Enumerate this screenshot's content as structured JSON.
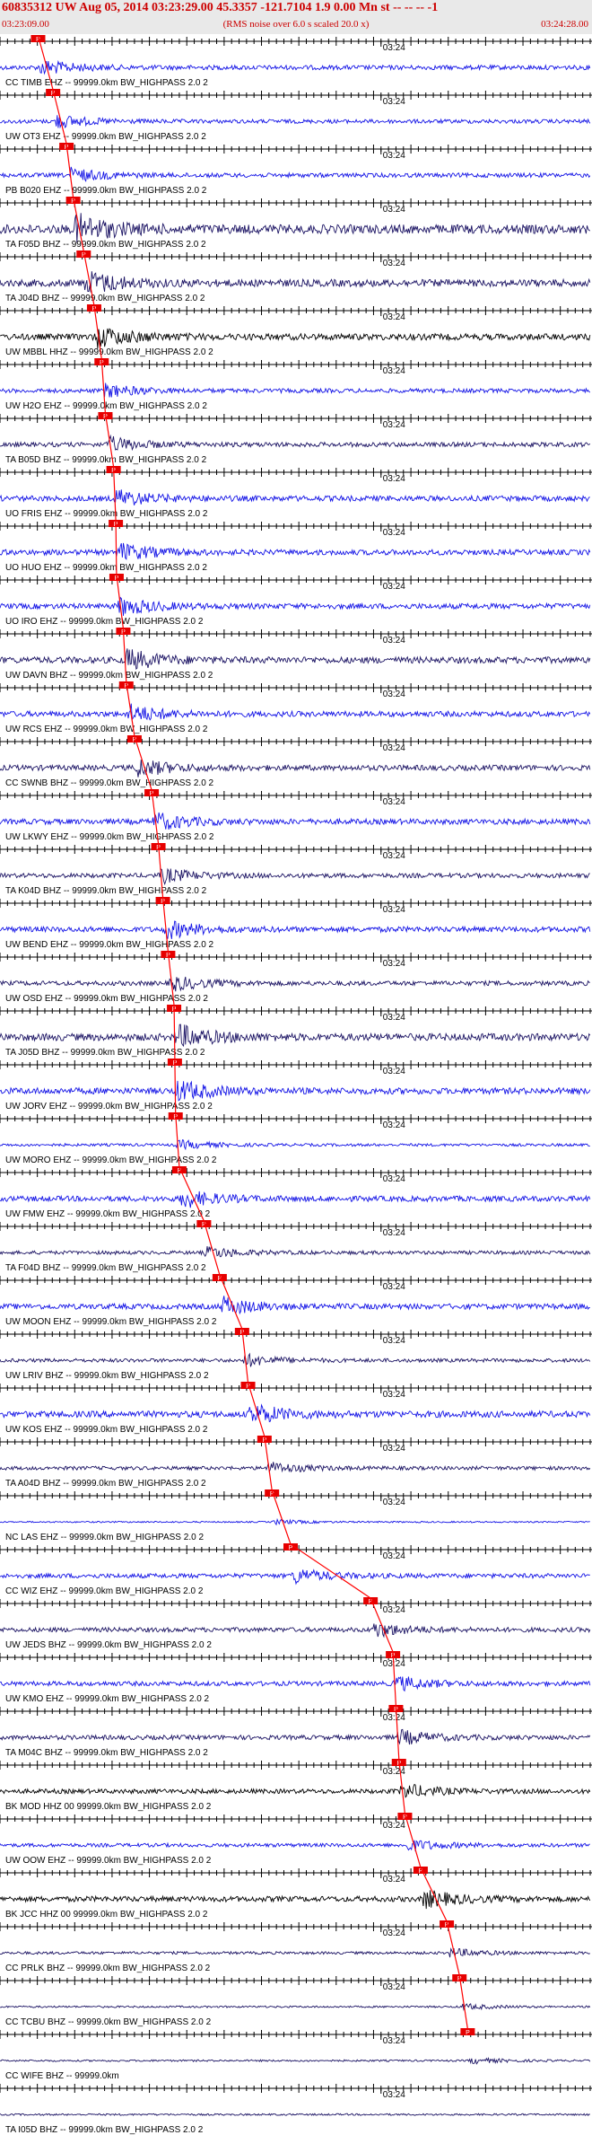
{
  "header": {
    "title": "60835312 UW Aug 05, 2014 03:23:29.00   45.3357 -121.7104  1.9 0.00 Mn st -- -- --  -1",
    "subtitle": "(RMS noise over 6.0 s scaled 20.0 x)",
    "start_time": "03:23:09.00",
    "end_time": "03:24:28.00",
    "title_color": "#cc0000"
  },
  "chart_data": {
    "type": "seismogram-record-section",
    "x_unit": "s",
    "time_window_s": [
      0,
      79
    ],
    "minute_mark_label": "03:24",
    "minute_mark_s": 51,
    "tick_major_s": 5,
    "tick_minor_s": 1,
    "pick_label": "P",
    "colors": {
      "blue": "#1414e6",
      "navy": "#1c1464",
      "black": "#000000",
      "pick": "#ff0000",
      "pick_box": "#e60000"
    },
    "traces": [
      {
        "label": "CC TIMB EHZ -- 99999.0km BW_HIGHPASS 2.0 2",
        "color": "blue",
        "amp": 2.5,
        "pick_s": 5.1
      },
      {
        "label": "UW OT3 EHZ -- 99999.0km BW_HIGHPASS 2.0 2",
        "color": "blue",
        "amp": 2.2,
        "pick_s": 7.1
      },
      {
        "label": "PB B020 EHZ -- 99999.0km BW_HIGHPASS 2.0 2",
        "color": "blue",
        "amp": 2.4,
        "pick_s": 8.9
      },
      {
        "label": "TA F05D BHZ -- 99999.0km BW_HIGHPASS 2.0 2",
        "color": "navy",
        "amp": 5.0,
        "pick_s": 9.8
      },
      {
        "label": "TA J04D BHZ -- 99999.0km BW_HIGHPASS 2.0 2",
        "color": "navy",
        "amp": 4.0,
        "pick_s": 11.2
      },
      {
        "label": "UW MBBL HHZ -- 99999.0km BW_HIGHPASS 2.0 2",
        "color": "black",
        "amp": 3.5,
        "pick_s": 12.6
      },
      {
        "label": "UW H2O EHZ -- 99999.0km BW_HIGHPASS 2.0 2",
        "color": "blue",
        "amp": 2.3,
        "pick_s": 13.6
      },
      {
        "label": "TA B05D BHZ -- 99999.0km BW_HIGHPASS 2.0 2",
        "color": "navy",
        "amp": 2.5,
        "pick_s": 14.1
      },
      {
        "label": "UO FRIS EHZ -- 99999.0km BW_HIGHPASS 2.0 2",
        "color": "blue",
        "amp": 3.0,
        "pick_s": 15.2
      },
      {
        "label": "UO HUO EHZ -- 99999.0km BW_HIGHPASS 2.0 2",
        "color": "blue",
        "amp": 3.0,
        "pick_s": 15.5
      },
      {
        "label": "UO IRO EHZ -- 99999.0km BW_HIGHPASS 2.0 2",
        "color": "blue",
        "amp": 3.0,
        "pick_s": 15.6
      },
      {
        "label": "UW DAVN BHZ -- 99999.0km BW_HIGHPASS 2.0 2",
        "color": "navy",
        "amp": 3.5,
        "pick_s": 16.5
      },
      {
        "label": "UW RCS EHZ -- 99999.0km BW_HIGHPASS 2.0 2",
        "color": "blue",
        "amp": 3.0,
        "pick_s": 16.9
      },
      {
        "label": "CC SWNB BHZ -- 99999.0km BW_HIGHPASS 2.0 2",
        "color": "navy",
        "amp": 3.0,
        "pick_s": 18.0
      },
      {
        "label": "UW LKWY EHZ -- 99999.0km BW_HIGHPASS 2.0 2",
        "color": "blue",
        "amp": 3.0,
        "pick_s": 20.3
      },
      {
        "label": "TA K04D BHZ -- 99999.0km BW_HIGHPASS 2.0 2",
        "color": "navy",
        "amp": 2.5,
        "pick_s": 21.2
      },
      {
        "label": "UW BEND EHZ -- 99999.0km BW_HIGHPASS 2.0 2",
        "color": "blue",
        "amp": 3.0,
        "pick_s": 21.8
      },
      {
        "label": "UW OSD EHZ -- 99999.0km BW_HIGHPASS 2.0 2",
        "color": "navy",
        "amp": 2.5,
        "pick_s": 22.5
      },
      {
        "label": "TA J05D BHZ -- 99999.0km BW_HIGHPASS 2.0 2",
        "color": "navy",
        "amp": 4.0,
        "pick_s": 23.3
      },
      {
        "label": "UW JORV EHZ -- 99999.0km BW_HIGHPASS 2.0 2",
        "color": "blue",
        "amp": 3.5,
        "pick_s": 23.4
      },
      {
        "label": "UW MORO EHZ -- 99999.0km BW_HIGHPASS 2.0 2",
        "color": "blue",
        "amp": 1.5,
        "pick_s": 23.5
      },
      {
        "label": "UW FMW EHZ -- 99999.0km BW_HIGHPASS 2.0 2",
        "color": "blue",
        "amp": 3.0,
        "pick_s": 24.0
      },
      {
        "label": "TA F04D BHZ -- 99999.0km BW_HIGHPASS 2.0 2",
        "color": "navy",
        "amp": 2.0,
        "pick_s": 27.3
      },
      {
        "label": "UW MOON EHZ -- 99999.0km BW_HIGHPASS 2.0 2",
        "color": "blue",
        "amp": 3.0,
        "pick_s": 29.4
      },
      {
        "label": "UW LRIV BHZ -- 99999.0km BW_HIGHPASS 2.0 2",
        "color": "navy",
        "amp": 2.0,
        "pick_s": 32.4
      },
      {
        "label": "UW KOS EHZ -- 99999.0km BW_HIGHPASS 2.0 2",
        "color": "blue",
        "amp": 3.5,
        "pick_s": 33.2
      },
      {
        "label": "TA A04D BHZ -- 99999.0km BW_HIGHPASS 2.0 2",
        "color": "navy",
        "amp": 2.0,
        "pick_s": 35.4
      },
      {
        "label": "NC LAS EHZ -- 99999.0km BW_HIGHPASS 2.0 2",
        "color": "blue",
        "amp": 0.8,
        "pick_s": 36.4
      },
      {
        "label": "CC WIZ EHZ -- 99999.0km BW_HIGHPASS 2.0 2",
        "color": "blue",
        "amp": 2.5,
        "pick_s": 38.9
      },
      {
        "label": "UW JEDS BHZ -- 99999.0km BW_HIGHPASS 2.0 2",
        "color": "navy",
        "amp": 2.5,
        "pick_s": 49.6
      },
      {
        "label": "UW KMO EHZ -- 99999.0km BW_HIGHPASS 2.0 2",
        "color": "blue",
        "amp": 2.5,
        "pick_s": 52.6
      },
      {
        "label": "TA M04C BHZ -- 99999.0km BW_HIGHPASS 2.0 2",
        "color": "navy",
        "amp": 2.5,
        "pick_s": 53.0
      },
      {
        "label": "BK MOD HHZ 00 99999.0km BW_HIGHPASS 2.0 2",
        "color": "black",
        "amp": 2.5,
        "pick_s": 53.4
      },
      {
        "label": "UW OOW EHZ -- 99999.0km BW_HIGHPASS 2.0 2",
        "color": "blue",
        "amp": 2.0,
        "pick_s": 54.2
      },
      {
        "label": "BK JCC HHZ 00 99999.0km BW_HIGHPASS 2.0 2",
        "color": "black",
        "amp": 3.0,
        "pick_s": 56.3
      },
      {
        "label": "CC PRLK BHZ -- 99999.0km BW_HIGHPASS 2.0 2",
        "color": "navy",
        "amp": 1.5,
        "pick_s": 59.8
      },
      {
        "label": "CC TCBU BHZ -- 99999.0km BW_HIGHPASS 2.0 2",
        "color": "navy",
        "amp": 1.0,
        "pick_s": 61.5
      },
      {
        "label": "CC WIFE BHZ -- 99999.0km",
        "color": "navy",
        "amp": 1.0,
        "pick_s": 62.6
      },
      {
        "label": "TA I05D BHZ -- 99999.0km BW_HIGHPASS 2.0 2",
        "color": "navy",
        "amp": 1.0,
        "pick_s": null
      }
    ]
  }
}
